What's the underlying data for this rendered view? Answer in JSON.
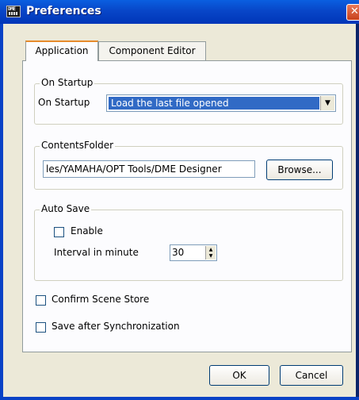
{
  "window": {
    "title": "Preferences",
    "icon_text": "DME"
  },
  "tabs": [
    {
      "label": "Application",
      "active": true
    },
    {
      "label": "Component Editor",
      "active": false
    }
  ],
  "startup": {
    "group_label": "On Startup",
    "field_label": "On Startup",
    "selected": "Load the last file opened"
  },
  "contents_folder": {
    "group_label": "ContentsFolder",
    "path": "les/YAMAHA/OPT Tools/DME Designer",
    "browse_label": "Browse..."
  },
  "auto_save": {
    "group_label": "Auto Save",
    "enable_label": "Enable",
    "interval_label": "Interval in minute",
    "interval_value": "30",
    "enabled": false
  },
  "options": {
    "confirm_scene_store": "Confirm Scene Store",
    "save_after_sync": "Save after Synchronization"
  },
  "buttons": {
    "ok": "OK",
    "cancel": "Cancel"
  }
}
